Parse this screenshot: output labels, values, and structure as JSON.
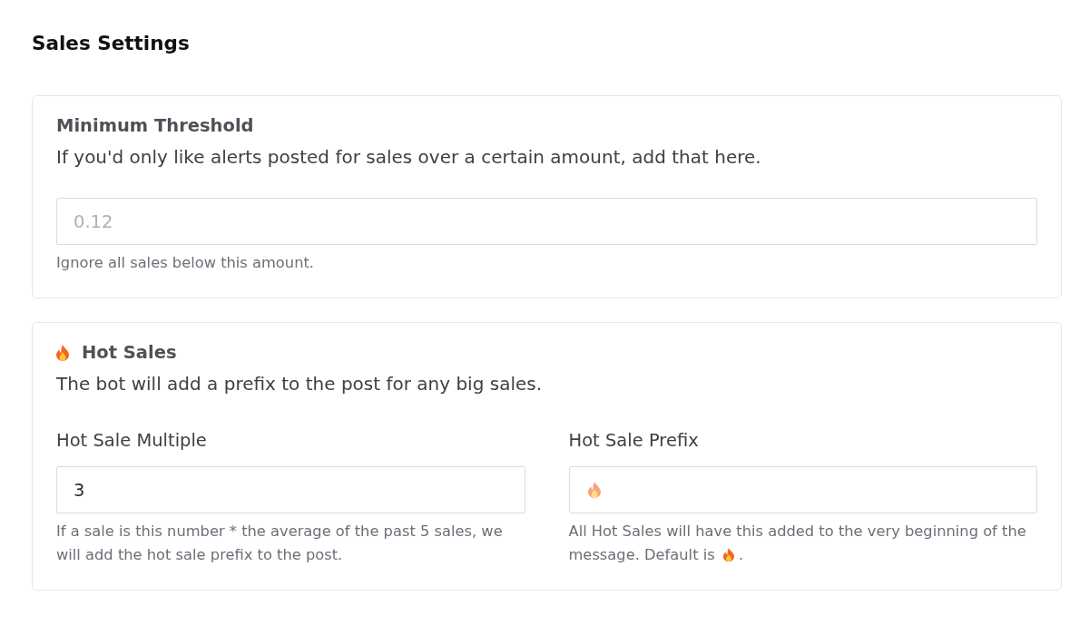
{
  "page": {
    "title": "Sales Settings"
  },
  "sections": [
    {
      "title": "Minimum Threshold",
      "description": "If you'd only like alerts posted for sales over a certain amount, add that here.",
      "fields": [
        {
          "placeholder": "0.12",
          "hint": "Ignore all sales below this amount."
        }
      ]
    },
    {
      "title": "Hot Sales",
      "title_icon": true,
      "description": "The bot will add a prefix to the post for any big sales.",
      "fields": [
        {
          "label": "Hot Sale Multiple",
          "value": "3",
          "hint": "If a sale is this number * the average of the past 5 sales, we will add the hot sale prefix to the post."
        },
        {
          "label": "Hot Sale Prefix",
          "placeholder_icon": true,
          "hint": "All Hot Sales will have this added to the very beginning of the message. Default is",
          "hint_icon": true,
          "hint_tail": "."
        }
      ]
    }
  ]
}
